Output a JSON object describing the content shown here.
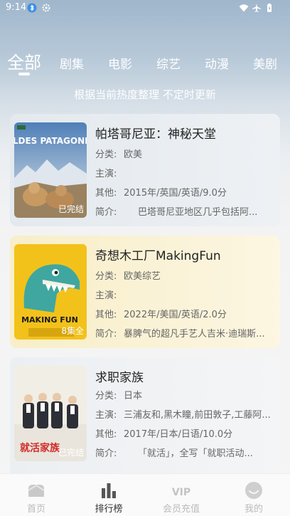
{
  "status": {
    "time": "9:14"
  },
  "tabs": [
    {
      "label": "全部",
      "active": true
    },
    {
      "label": "剧集"
    },
    {
      "label": "电影"
    },
    {
      "label": "综艺"
    },
    {
      "label": "动漫"
    },
    {
      "label": "美剧"
    }
  ],
  "subtitle": "根据当前热度整理 不定时更新",
  "cards": [
    {
      "title": "帕塔哥尼亚：神秘天堂",
      "badge": "已完结",
      "poster_text": "WILDES PATAGONIEN",
      "rows": [
        {
          "label": "分类:",
          "value": "欧美"
        },
        {
          "label": "主演:",
          "value": ""
        },
        {
          "label": "其他:",
          "value": "2015年/英国/英语/9.0分"
        },
        {
          "label": "简介:",
          "value": "巴塔哥尼亚地区几乎包括阿..."
        }
      ]
    },
    {
      "title": "奇想木工厂MakingFun",
      "badge": "8集全",
      "poster_text": "MAKING FUN",
      "rows": [
        {
          "label": "分类:",
          "value": "欧美综艺"
        },
        {
          "label": "主演:",
          "value": ""
        },
        {
          "label": "其他:",
          "value": "2022年/美国/英语/2.0分"
        },
        {
          "label": "简介:",
          "value": "暴脾气的超凡手艺人吉米·迪瑞斯..."
        }
      ]
    },
    {
      "title": "求职家族",
      "badge": "已完结",
      "poster_text": "就活家族",
      "rows": [
        {
          "label": "分类:",
          "value": "日本"
        },
        {
          "label": "主演:",
          "value": "三浦友和,黑木瞳,前田敦子,工藤阿..."
        },
        {
          "label": "其他:",
          "value": "2017年/日本/日语/10.0分"
        },
        {
          "label": "简介:",
          "value": "「就活」，全写「就职活动..."
        }
      ]
    }
  ],
  "nav": [
    {
      "label": "首页",
      "icon": "home-icon"
    },
    {
      "label": "排行榜",
      "icon": "ranking-icon",
      "active": true
    },
    {
      "label": "会员充值",
      "icon": "vip-icon"
    },
    {
      "label": "我的",
      "icon": "profile-icon"
    }
  ],
  "colors": {
    "accent": "#333333",
    "inactive": "#bbbbbb",
    "card1": "#e6ebef",
    "card2": "#fbf3d9",
    "card3": "#eff1f3"
  }
}
